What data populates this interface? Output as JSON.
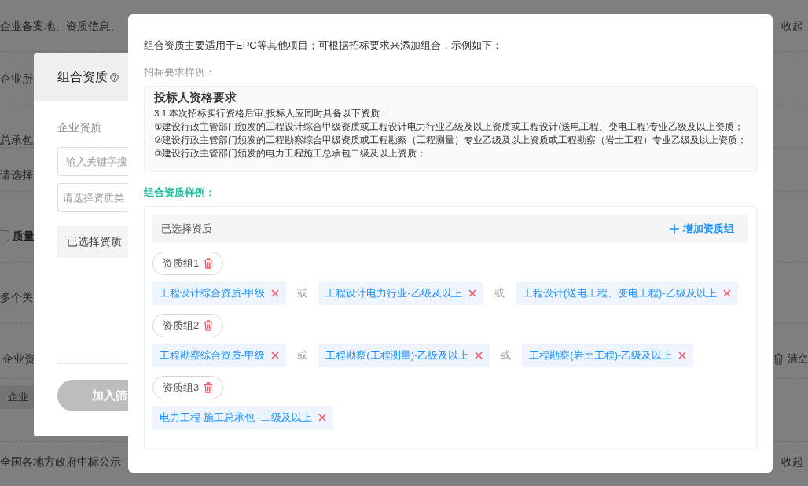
{
  "background": {
    "rows": [
      {
        "kind": "text",
        "text": "企业备案地、资质信息、",
        "action": {
          "kind": "collapse",
          "text": "收起"
        }
      },
      {
        "kind": "text",
        "text": "企业所"
      },
      {
        "kind": "text",
        "text": "总承包"
      },
      {
        "kind": "text",
        "text": "请选择"
      },
      {
        "kind": "checkbox",
        "text": "质量",
        "checked": false
      },
      {
        "kind": "text",
        "text": "多个关"
      },
      {
        "kind": "text",
        "text": "企业资",
        "action": {
          "kind": "clear",
          "text": "清空"
        }
      },
      {
        "kind": "tag",
        "text": "企业"
      },
      {
        "kind": "text",
        "text": "全国各地方政府中标公示",
        "action": {
          "kind": "collapse",
          "text": "收起"
        }
      }
    ]
  },
  "panel": {
    "title": "组合资质",
    "label": "企业资质",
    "search_placeholder": "输入关键字搜",
    "select_placeholder": "请选择资质类",
    "selected_label": "已选择资质",
    "button": "加入筛",
    "button_disabled": true
  },
  "modal": {
    "intro": "组合资质主要适用于EPC等其他项目；可根据招标要求来添加组合，示例如下：",
    "sample_label": "招标要求样例：",
    "sample": {
      "title": "投标人资格要求",
      "lines": [
        "3.1 本次招标实行资格后审,投标人应同时具备以下资质：",
        "①建设行政主管部门颁发的工程设计综合甲级资质或工程设计电力行业乙级及以上资质或工程设计(送电工程、变电工程)专业乙级及以上资质；",
        "②建设行政主管部门颁发的工程勘察综合甲级资质或工程勘察（工程测量）专业乙级及以上资质或工程勘察（岩土工程）专业乙级及以上资质；",
        "③建设行政主管部门颁发的电力工程施工总承包二级及以上资质；"
      ]
    },
    "example_label": "组合资质样例：",
    "selected_header": "已选择资质",
    "add_button": "增加资质组",
    "groups": [
      {
        "label": "资质组1",
        "items": [
          {
            "kind": "tag",
            "text": "工程设计综合资质-甲级"
          },
          {
            "kind": "or",
            "text": "或"
          },
          {
            "kind": "tag",
            "text": "工程设计电力行业-乙级及以上"
          },
          {
            "kind": "or",
            "text": "或"
          },
          {
            "kind": "tag",
            "text": "工程设计(送电工程、变电工程)-乙级及以上"
          }
        ]
      },
      {
        "label": "资质组2",
        "items": [
          {
            "kind": "tag",
            "text": "工程勘察综合资质-甲级"
          },
          {
            "kind": "or",
            "text": "或"
          },
          {
            "kind": "tag",
            "text": "工程勘察(工程测量)-乙级及以上"
          },
          {
            "kind": "or",
            "text": "或"
          },
          {
            "kind": "tag",
            "text": "工程勘察(岩土工程)-乙级及以上"
          }
        ]
      },
      {
        "label": "资质组3",
        "items": [
          {
            "kind": "tag",
            "text": "电力工程-施工总承包 -二级及以上"
          }
        ]
      }
    ]
  }
}
